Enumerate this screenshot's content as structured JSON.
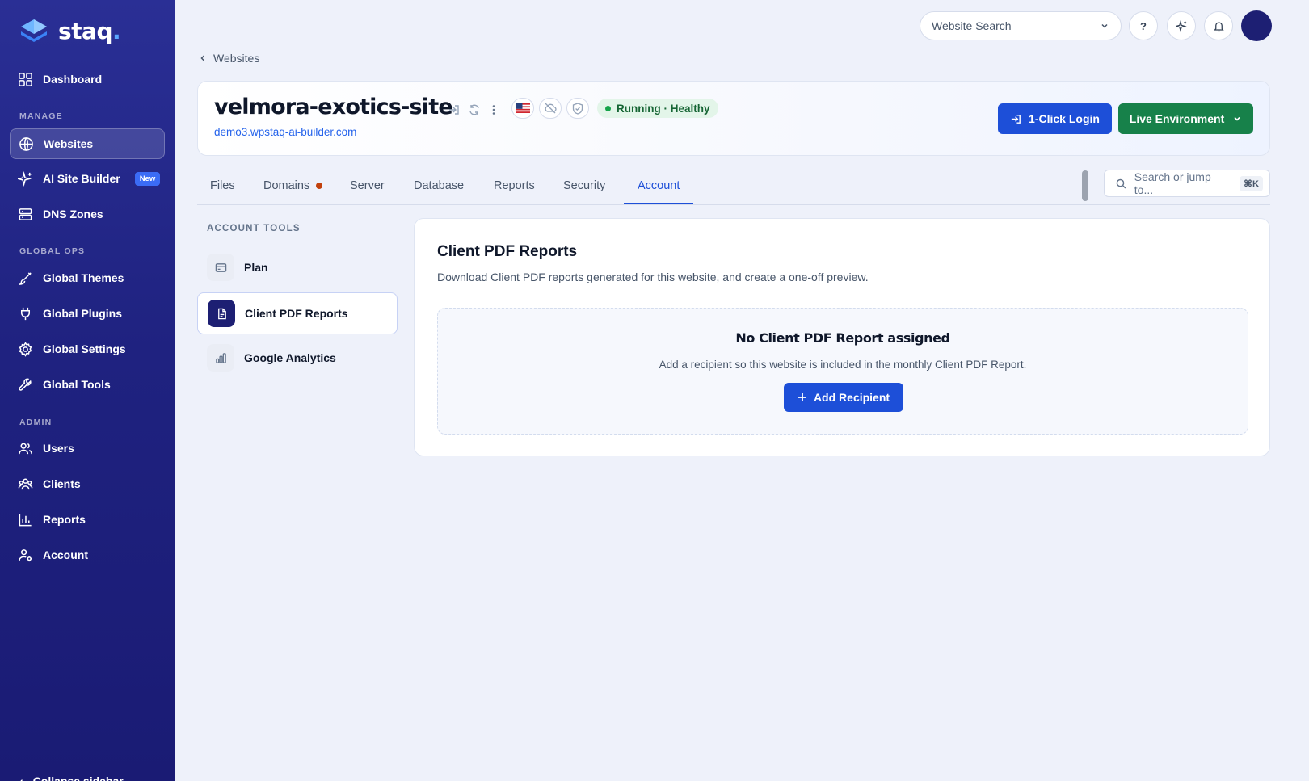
{
  "app": {
    "logo_text": "staq",
    "logo_dot": "."
  },
  "sidebar": {
    "items_top": [
      {
        "label": "Dashboard",
        "icon": "grid-icon"
      }
    ],
    "section_manage": "MANAGE",
    "manage": [
      {
        "label": "Websites",
        "icon": "globe-icon",
        "active": true
      },
      {
        "label": "AI Site Builder",
        "icon": "sparkle-icon",
        "badge": "New"
      },
      {
        "label": "DNS Zones",
        "icon": "server-icon"
      }
    ],
    "section_global": "GLOBAL OPS",
    "global": [
      {
        "label": "Global Themes",
        "icon": "brush-icon"
      },
      {
        "label": "Global Plugins",
        "icon": "plug-icon"
      },
      {
        "label": "Global Settings",
        "icon": "gear-icon"
      },
      {
        "label": "Global Tools",
        "icon": "wrench-icon"
      }
    ],
    "section_admin": "ADMIN",
    "admin": [
      {
        "label": "Users",
        "icon": "users-icon"
      },
      {
        "label": "Clients",
        "icon": "clients-icon"
      },
      {
        "label": "Reports",
        "icon": "bar-chart-icon"
      },
      {
        "label": "Account",
        "icon": "user-gear-icon"
      }
    ],
    "collapse_label": "Collapse sidebar"
  },
  "topbar": {
    "search_placeholder": "Website Search",
    "help_label": "?"
  },
  "breadcrumb": {
    "back_label": "Websites"
  },
  "site": {
    "name": "velmora-exotics-site",
    "url": "demo3.wpstaq-ai-builder.com",
    "status": "Running · Healthy",
    "login_button": "1-Click Login",
    "env_button": "Live Environment"
  },
  "tabs": [
    {
      "label": "Files"
    },
    {
      "label": "Domains",
      "dot": true
    },
    {
      "label": "Server"
    },
    {
      "label": "Database"
    },
    {
      "label": "Reports"
    },
    {
      "label": "Security"
    },
    {
      "label": "Account",
      "active": true
    }
  ],
  "jump": {
    "placeholder": "Search or jump to...",
    "shortcut": "⌘K"
  },
  "tools": {
    "title": "ACCOUNT TOOLS",
    "items": [
      {
        "label": "Plan",
        "icon": "card-icon"
      },
      {
        "label": "Client PDF Reports",
        "icon": "document-icon",
        "active": true
      },
      {
        "label": "Google Analytics",
        "icon": "analytics-icon"
      }
    ]
  },
  "panel": {
    "title": "Client PDF Reports",
    "subtitle": "Download Client PDF reports generated for this website, and create a one-off preview.",
    "empty_title": "No Client PDF Report assigned",
    "empty_sub": "Add a recipient so this website is included in the monthly Client PDF Report.",
    "add_button": "Add Recipient"
  },
  "colors": {
    "primary": "#1d4fd8",
    "success": "#17814a",
    "sidebar": "#1f2280"
  }
}
